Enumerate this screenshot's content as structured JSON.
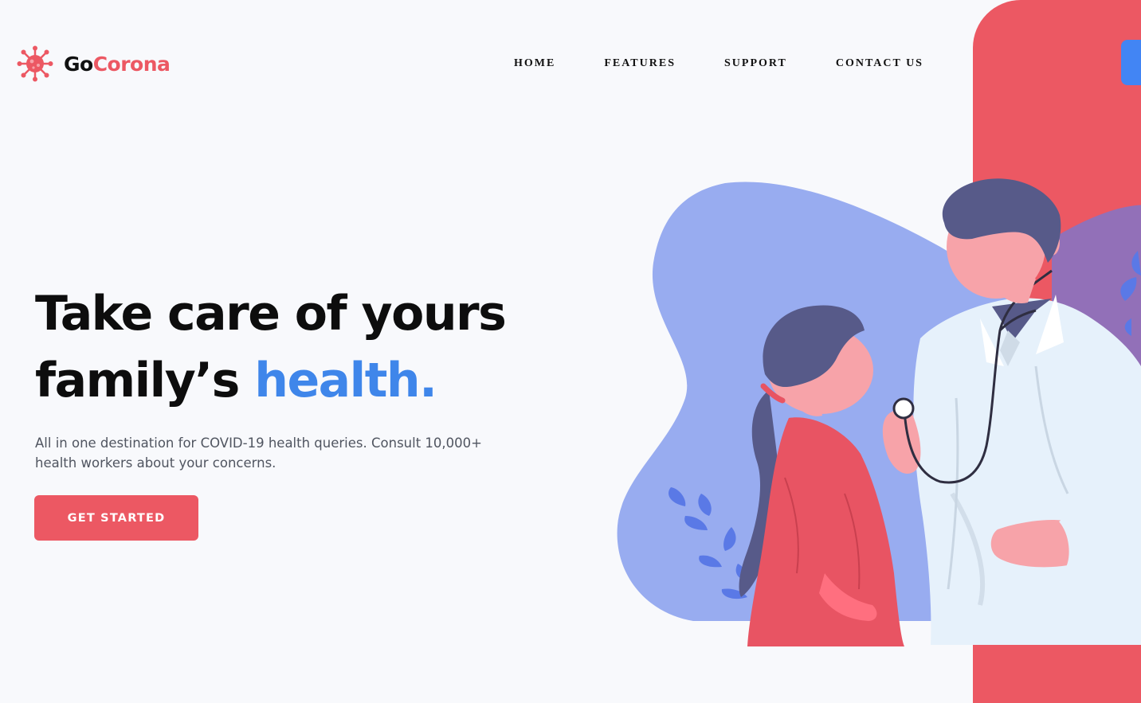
{
  "brand": {
    "name_prefix": "Go",
    "name_suffix": "Corona",
    "logo_icon": "virus-icon"
  },
  "nav": {
    "items": [
      {
        "label": "HOME"
      },
      {
        "label": "FEATURES"
      },
      {
        "label": "SUPPORT"
      },
      {
        "label": "CONTACT US"
      }
    ]
  },
  "hero": {
    "title_line1": "Take care of yours",
    "title_line2_prefix": "family’s ",
    "title_line2_accent": "health.",
    "subtitle": "All in one destination for COVID-19 health queries. Consult 10,000+ health workers about your concerns.",
    "cta_label": "GET STARTED"
  },
  "illustration": {
    "subject": "doctor-examining-girl-illustration"
  },
  "colors": {
    "primary_red": "#ec5863",
    "accent_blue": "#3f86ea",
    "blob_blue": "#98acf0",
    "background": "#f8f9fc",
    "text_dark": "#0d0d0d"
  }
}
